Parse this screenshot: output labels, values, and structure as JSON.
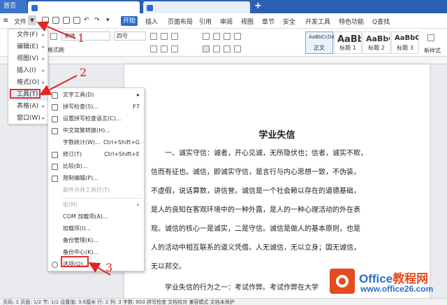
{
  "tabs": {
    "home": "首页"
  },
  "menu": {
    "file": "文件",
    "start": "开始",
    "items": [
      "插入",
      "页面布局",
      "引用",
      "审阅",
      "视图",
      "章节",
      "安全",
      "开发工具",
      "特色功能"
    ],
    "search": "Q查找"
  },
  "ribbon": {
    "font": "宋体",
    "size": "四号",
    "brush": "格式刷",
    "styles": [
      {
        "sample": "AaBbCcDd",
        "name": "正文"
      },
      {
        "sample": "AaBb",
        "name": "标题 1"
      },
      {
        "sample": "AaBbC",
        "name": "标题 2"
      },
      {
        "sample": "AaBbC",
        "name": "标题 3"
      }
    ],
    "new_style": "新样式"
  },
  "file_menu": {
    "items": [
      {
        "label": "文件(F)"
      },
      {
        "label": "编辑(E)"
      },
      {
        "label": "视图(V)"
      },
      {
        "label": "插入(I)"
      },
      {
        "label": "格式(O)"
      },
      {
        "label": "工具(T)"
      },
      {
        "label": "表格(A)"
      },
      {
        "label": "窗口(W)"
      }
    ]
  },
  "tools_menu": {
    "items": [
      {
        "label": "文字工具(D)",
        "shortcut": "",
        "disabled": false
      },
      {
        "label": "拼写检查(S)...",
        "shortcut": "F7",
        "disabled": false
      },
      {
        "label": "设置拼写检查语言(C)...",
        "shortcut": "",
        "disabled": false
      },
      {
        "label": "中文简繁转换(H)...",
        "shortcut": "",
        "disabled": false
      },
      {
        "label": "字数统计(W)...",
        "shortcut": "Ctrl+Shift+G",
        "disabled": false
      },
      {
        "label": "修订(T)",
        "shortcut": "Ctrl+Shift+E",
        "disabled": false
      },
      {
        "label": "比较(B)...",
        "shortcut": "",
        "disabled": false
      },
      {
        "label": "限制编辑(P)...",
        "shortcut": "",
        "disabled": false
      },
      {
        "label": "邮件合并工具栏(T)",
        "shortcut": "",
        "disabled": true
      },
      {
        "label": "宏(M)",
        "shortcut": "",
        "disabled": true
      },
      {
        "label": "COM 加载项(A)...",
        "shortcut": "",
        "disabled": false
      },
      {
        "label": "加载项(I)...",
        "shortcut": "",
        "disabled": false
      },
      {
        "label": "备份管理(K)...",
        "shortcut": "",
        "disabled": false
      },
      {
        "label": "备份中心(K)...",
        "shortcut": "",
        "disabled": false
      },
      {
        "label": "选项(O)...",
        "shortcut": "",
        "disabled": false
      }
    ]
  },
  "annotations": [
    "1",
    "2",
    "3"
  ],
  "document": {
    "title": "学业失信",
    "lines": [
      "一、诚实守信：诚者，开心见诚，无所隐伏也；信者，诚实不欺，",
      "信而有征也。诚信，即诚实守信，是言行与内心思想一致，不伪装，",
      "不虚假，说话算数，讲信誉。诚信是一个社会赖以存在的道德基础，",
      "是人的良知在客观环境中的一种外露，是人的一种心理活动的外在表",
      "现。诚信的核心一是诚实，二是守信。诚信是做人的基本原则，也是",
      "人的活动中相互联系的道义凭借。人无诚信，无以立身；国无诚信，",
      "无以邦交。",
      "学业失信的行为之一：考试作弊。考试作弊在大学"
    ]
  },
  "statusbar": "页码: 1   页面: 1/2   节: 1/1   设置值: 3.6厘米   行: 2   列: 3   字数: 850   拼写检查   文档校对   兼容模式   文档未保护",
  "watermark": {
    "brand1": "Office",
    "brand2": "教程网",
    "url": "www.office26.com"
  }
}
